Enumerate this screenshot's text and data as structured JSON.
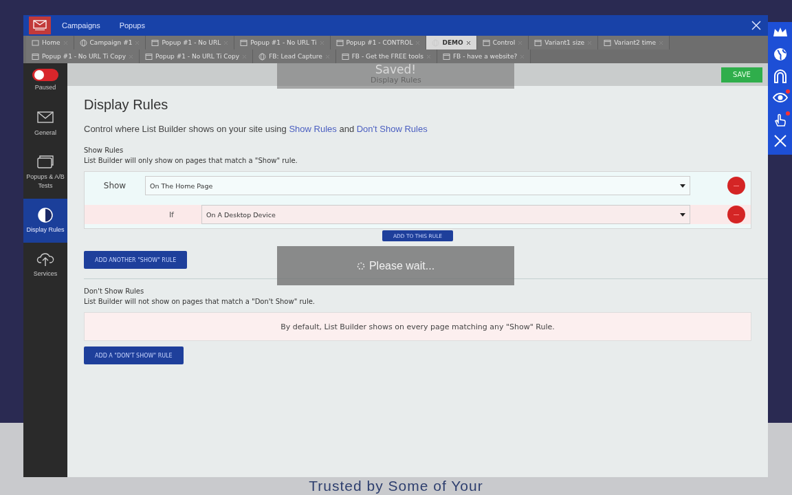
{
  "header": {
    "nav": [
      "Campaigns",
      "Popups"
    ]
  },
  "tabs": [
    [
      {
        "label": "Home",
        "kind": "home",
        "selected": false
      },
      {
        "label": "Campaign #1",
        "kind": "globe",
        "selected": false
      },
      {
        "label": "Popup #1 - No URL",
        "kind": "window",
        "selected": false
      },
      {
        "label": "Popup #1 - No URL Ti",
        "kind": "window",
        "selected": false
      },
      {
        "label": "Popup #1 - CONTROL",
        "kind": "window",
        "selected": false
      },
      {
        "label": "DEMO",
        "kind": "globe",
        "selected": true
      },
      {
        "label": "Control",
        "kind": "window",
        "selected": false
      },
      {
        "label": "Variant1 size",
        "kind": "window",
        "selected": false
      },
      {
        "label": "Variant2 time",
        "kind": "window",
        "selected": false
      }
    ],
    [
      {
        "label": "Popup #1 - No URL Ti Copy",
        "kind": "window",
        "selected": false
      },
      {
        "label": "Popup #1 - No URL Ti Copy",
        "kind": "window",
        "selected": false
      },
      {
        "label": "FB: Lead Capture",
        "kind": "globe",
        "selected": false
      },
      {
        "label": "FB - Get the FREE tools",
        "kind": "window",
        "selected": false
      },
      {
        "label": "FB - have a website?",
        "kind": "window",
        "selected": false
      }
    ]
  ],
  "sidebar": {
    "status": {
      "label": "Paused",
      "on": false
    },
    "items": [
      {
        "label": "General",
        "kind": "envelope",
        "selected": false
      },
      {
        "label": "Popups & A/B Tests",
        "kind": "popups",
        "selected": false
      },
      {
        "label": "Display Rules",
        "kind": "contrast",
        "selected": true
      },
      {
        "label": "Services",
        "kind": "cloud",
        "selected": false
      }
    ]
  },
  "toolbar": {
    "breadcrumb": "Display Rules",
    "save": "SAVE"
  },
  "toast": "Saved!",
  "title": "Display Rules",
  "intro": {
    "before": "Control where List Builder shows on your site using ",
    "link_1": "Show Rules",
    "middle": " and ",
    "link_2": "Don't Show Rules"
  },
  "show_rules": {
    "heading": "Show Rules",
    "description": "List Builder will only show on pages that match a \"Show\" rule.",
    "rules": [
      {
        "label": "Show",
        "value": "On The Home Page",
        "conditions": [
          {
            "label": "If",
            "value": "On A Desktop Device"
          }
        ],
        "add_condition": "ADD TO THIS RULE"
      }
    ],
    "add_rule": "ADD ANOTHER \"SHOW\" RULE"
  },
  "dont_show_rules": {
    "heading": "Don't Show Rules",
    "description": "List Builder will not show on pages that match a \"Don't Show\" rule.",
    "empty": "By default, List Builder shows on every page matching any \"Show\" Rule.",
    "add_rule": "ADD A \"DON'T SHOW\" RULE"
  },
  "loading": "Please wait...",
  "side_icons": [
    {
      "kind": "crown",
      "alert": false
    },
    {
      "kind": "globe",
      "alert": false
    },
    {
      "kind": "magnet",
      "alert": false
    },
    {
      "kind": "eye",
      "alert": true
    },
    {
      "kind": "hand",
      "alert": true
    },
    {
      "kind": "close",
      "alert": false
    }
  ],
  "background_text": "Trusted by Some of Your"
}
